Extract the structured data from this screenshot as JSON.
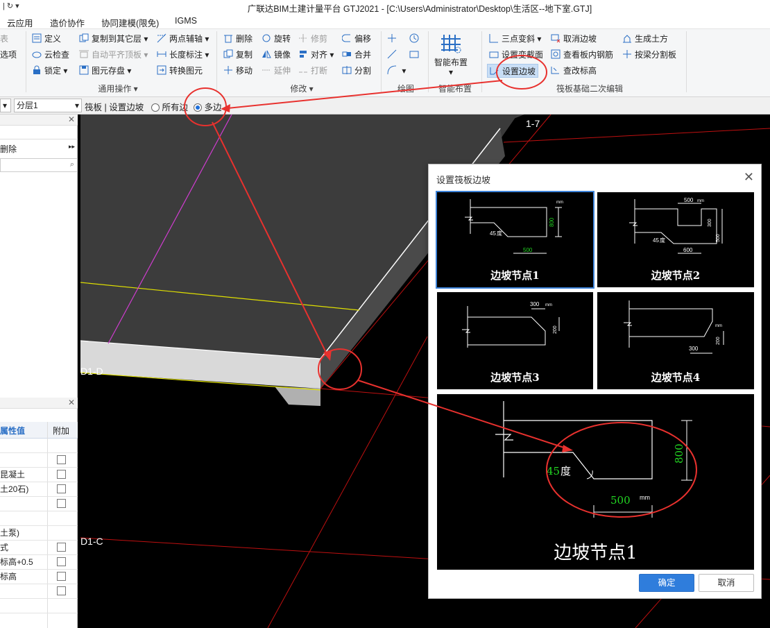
{
  "titlebar": {
    "quick_access": "| ↻ ▾",
    "title": "广联达BIM土建计量平台 GTJ2021 - [C:\\Users\\Administrator\\Desktop\\生活区--地下室.GTJ]"
  },
  "menu": [
    "云应用",
    "造价协作",
    "协同建模(限免)",
    "IGMS"
  ],
  "ribbon": {
    "left_partial": [
      "表",
      "选项"
    ],
    "general": {
      "items": [
        "定义",
        "复制到其它层",
        "两点辅轴",
        "云检查",
        "自动平齐顶板",
        "长度标注",
        "锁定",
        "图元存盘",
        "转换图元"
      ],
      "label": "通用操作"
    },
    "modify": {
      "items": [
        "删除",
        "旋转",
        "修剪",
        "偏移",
        "复制",
        "镜像",
        "对齐",
        "合并",
        "移动",
        "延伸",
        "打断",
        "分割"
      ],
      "label": "修改"
    },
    "draw": {
      "label": "绘图"
    },
    "smart": {
      "button": "智能布置",
      "label": "智能布置"
    },
    "raft_edit": {
      "items": [
        "三点变斜",
        "取消边坡",
        "生成土方",
        "设置变截面",
        "查看板内钢筋",
        "按梁分割板",
        "设置边坡",
        "查改标高"
      ],
      "label": "筏板基础二次编辑"
    }
  },
  "propbar": {
    "layer": "分层1",
    "crumb": "筏板 | 设置边坡",
    "radio_all": "所有边",
    "radio_multi": "多边",
    "selected": "多边"
  },
  "leftpanel": {
    "top_item": "删除",
    "header_value": "属性值",
    "header_extra": "附加",
    "rows": [
      "",
      "",
      "昆凝土",
      "土20石)",
      "",
      "",
      "土泵)",
      "式",
      "标高+0.5",
      "标高",
      "",
      ""
    ]
  },
  "viewport": {
    "axis_labels": [
      "1-7",
      "D1-D",
      "D1-C"
    ]
  },
  "dialog": {
    "title": "设置筏板边坡",
    "options": [
      {
        "caption": "边坡节点1",
        "angle": "45",
        "angle_unit": "度",
        "w": "500",
        "h": "800",
        "unit": "mm"
      },
      {
        "caption": "边坡节点2",
        "w1": "500",
        "w2": "600",
        "h1": "300",
        "h2": "500",
        "angle": "45",
        "angle_unit": "度",
        "unit": "mm"
      },
      {
        "caption": "边坡节点3",
        "w": "300",
        "h": "200",
        "unit": "mm"
      },
      {
        "caption": "边坡节点4",
        "w": "300",
        "h": "200",
        "unit": "mm"
      }
    ],
    "preview": {
      "caption": "边坡节点1",
      "angle": "45",
      "angle_unit": "度",
      "w": "500",
      "h": "800",
      "unit": "mm"
    },
    "ok": "确定",
    "cancel": "取消"
  },
  "colors": {
    "accent": "#2f7ddc",
    "annotation": "#e8312e",
    "dim_text": "#22d622"
  }
}
